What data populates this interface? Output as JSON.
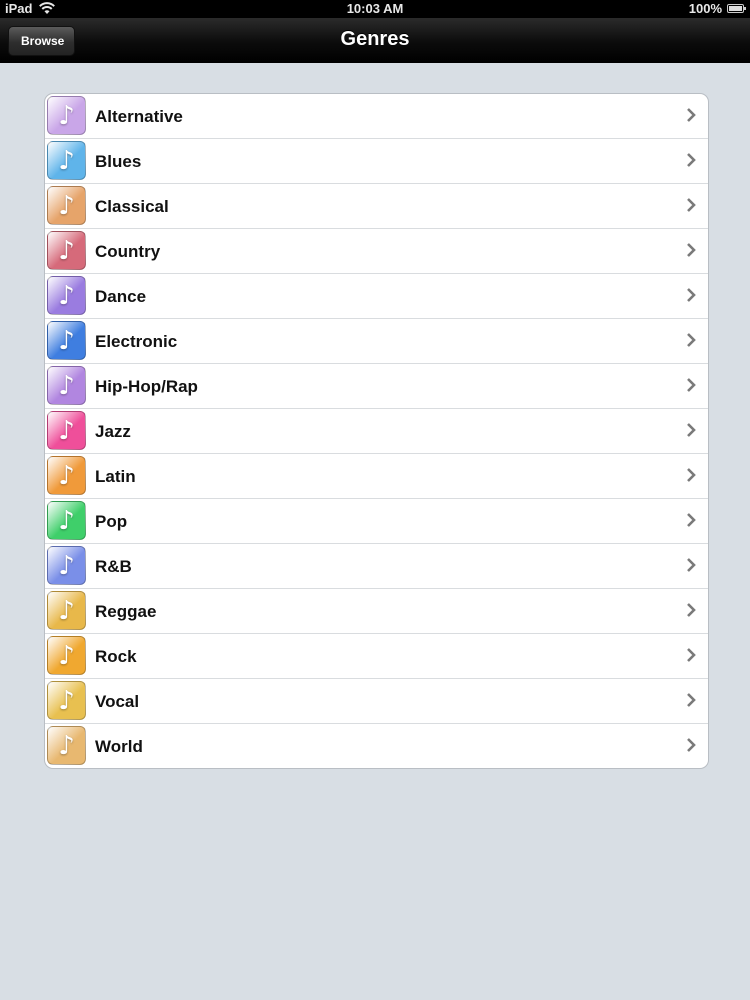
{
  "status_bar": {
    "carrier": "iPad",
    "time": "10:03 AM",
    "battery": "100%"
  },
  "nav": {
    "title": "Genres",
    "back_label": "Browse"
  },
  "genres": [
    {
      "label": "Alternative",
      "color": "#c9a6e8"
    },
    {
      "label": "Blues",
      "color": "#5fb4ea"
    },
    {
      "label": "Classical",
      "color": "#e6a46a"
    },
    {
      "label": "Country",
      "color": "#d66a7a"
    },
    {
      "label": "Dance",
      "color": "#9a7ce0"
    },
    {
      "label": "Electronic",
      "color": "#3f7ee0"
    },
    {
      "label": "Hip-Hop/Rap",
      "color": "#b186e0"
    },
    {
      "label": "Jazz",
      "color": "#ef4f9a"
    },
    {
      "label": "Latin",
      "color": "#f09a3a"
    },
    {
      "label": "Pop",
      "color": "#3fcf6a"
    },
    {
      "label": "R&B",
      "color": "#7a8fe8"
    },
    {
      "label": "Reggae",
      "color": "#e8b84a"
    },
    {
      "label": "Rock",
      "color": "#f0a830"
    },
    {
      "label": "Vocal",
      "color": "#e8c050"
    },
    {
      "label": "World",
      "color": "#e8b870"
    }
  ]
}
